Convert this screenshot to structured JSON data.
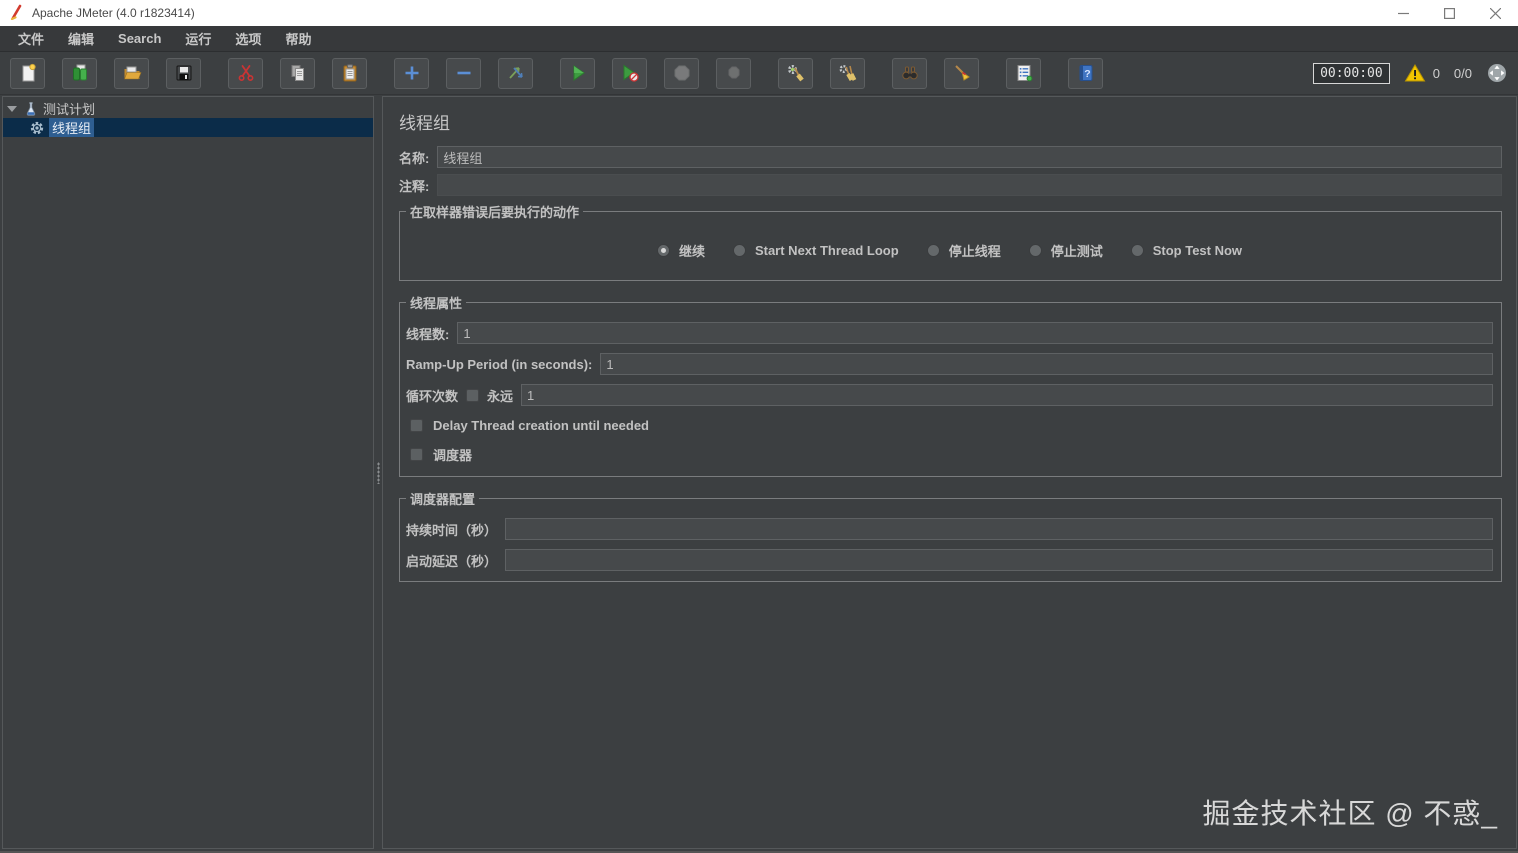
{
  "colors": {
    "titlebar_bg": "#ffffff",
    "ui_bg": "#3c3f41",
    "input_bg": "#46494b",
    "selection_row": "#0b2c49",
    "selection_label": "#2e5e91",
    "warning_yellow": "#f2c500",
    "start_green": "#3d9c40",
    "accent_blue": "#5b8fd6"
  },
  "window": {
    "title": "Apache JMeter (4.0 r1823414)",
    "icons": [
      "jmeter-logo",
      "minimize",
      "maximize",
      "close"
    ]
  },
  "menu": {
    "items": [
      {
        "label": "文件"
      },
      {
        "label": "编辑"
      },
      {
        "label": "Search"
      },
      {
        "label": "运行"
      },
      {
        "label": "选项"
      },
      {
        "label": "帮助"
      }
    ]
  },
  "toolbar": {
    "icons": [
      "new-file",
      "templates",
      "open",
      "save",
      "cut",
      "copy",
      "paste",
      "expand-all",
      "collapse-all",
      "toggle",
      "start",
      "start-no-pauses",
      "stop",
      "shutdown",
      "clear",
      "clear-all",
      "search",
      "search-reset",
      "function-helper",
      "help",
      "warning-triangle",
      "remote-status"
    ],
    "timer": "00:00:00",
    "error_count": "0",
    "thread_count": "0/0"
  },
  "tree": {
    "items": [
      {
        "label": "测试计划",
        "icon": "test-plan-flask",
        "expanded": true,
        "selected": false
      },
      {
        "label": "线程组",
        "icon": "thread-group-gear",
        "selected": true
      }
    ]
  },
  "main": {
    "title": "线程组",
    "name": {
      "label": "名称:",
      "value": "线程组"
    },
    "comments": {
      "label": "注释:",
      "value": ""
    },
    "sampler_error": {
      "title": "在取样器错误后要执行的动作",
      "options": [
        {
          "label": "继续",
          "selected": true
        },
        {
          "label": "Start Next Thread Loop",
          "selected": false
        },
        {
          "label": "停止线程",
          "selected": false
        },
        {
          "label": "停止测试",
          "selected": false
        },
        {
          "label": "Stop Test Now",
          "selected": false
        }
      ]
    },
    "thread_props": {
      "title": "线程属性",
      "threads": {
        "label": "线程数:",
        "value": "1"
      },
      "rampup": {
        "label": "Ramp-Up Period (in seconds):",
        "value": "1"
      },
      "loop": {
        "label": "循环次数",
        "forever_label": "永远",
        "forever_checked": false,
        "value": "1"
      },
      "delay_creation": {
        "label": "Delay Thread creation until needed",
        "checked": false
      },
      "scheduler": {
        "label": "调度器",
        "checked": false
      }
    },
    "scheduler_config": {
      "title": "调度器配置",
      "duration": {
        "label": "持续时间（秒）",
        "value": ""
      },
      "startup_delay": {
        "label": "启动延迟（秒）",
        "value": ""
      }
    }
  },
  "watermark": "掘金技术社区 @ 不惑_"
}
